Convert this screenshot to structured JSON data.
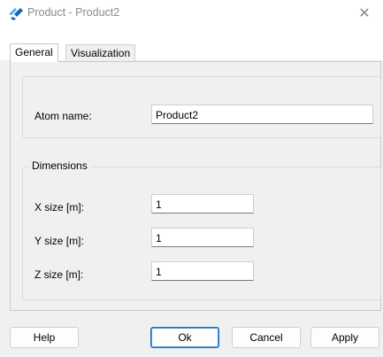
{
  "window": {
    "title": "Product - Product2",
    "icon": "app-logo-icon",
    "close_glyph": "✕"
  },
  "tabs": [
    {
      "label": "General",
      "active": true
    },
    {
      "label": "Visualization",
      "active": false
    }
  ],
  "general": {
    "atom_name_label": "Atom name:",
    "atom_name_value": "Product2",
    "dimensions_title": "Dimensions",
    "x_label": "X size [m]:",
    "x_value": "1",
    "y_label": "Y size [m]:",
    "y_value": "1",
    "z_label": "Z size [m]:",
    "z_value": "1"
  },
  "buttons": {
    "help": "Help",
    "ok": "Ok",
    "cancel": "Cancel",
    "apply": "Apply"
  },
  "colors": {
    "accent": "#1a6fc4",
    "logo_light": "#4fb3e8",
    "logo_dark": "#1565b0"
  }
}
